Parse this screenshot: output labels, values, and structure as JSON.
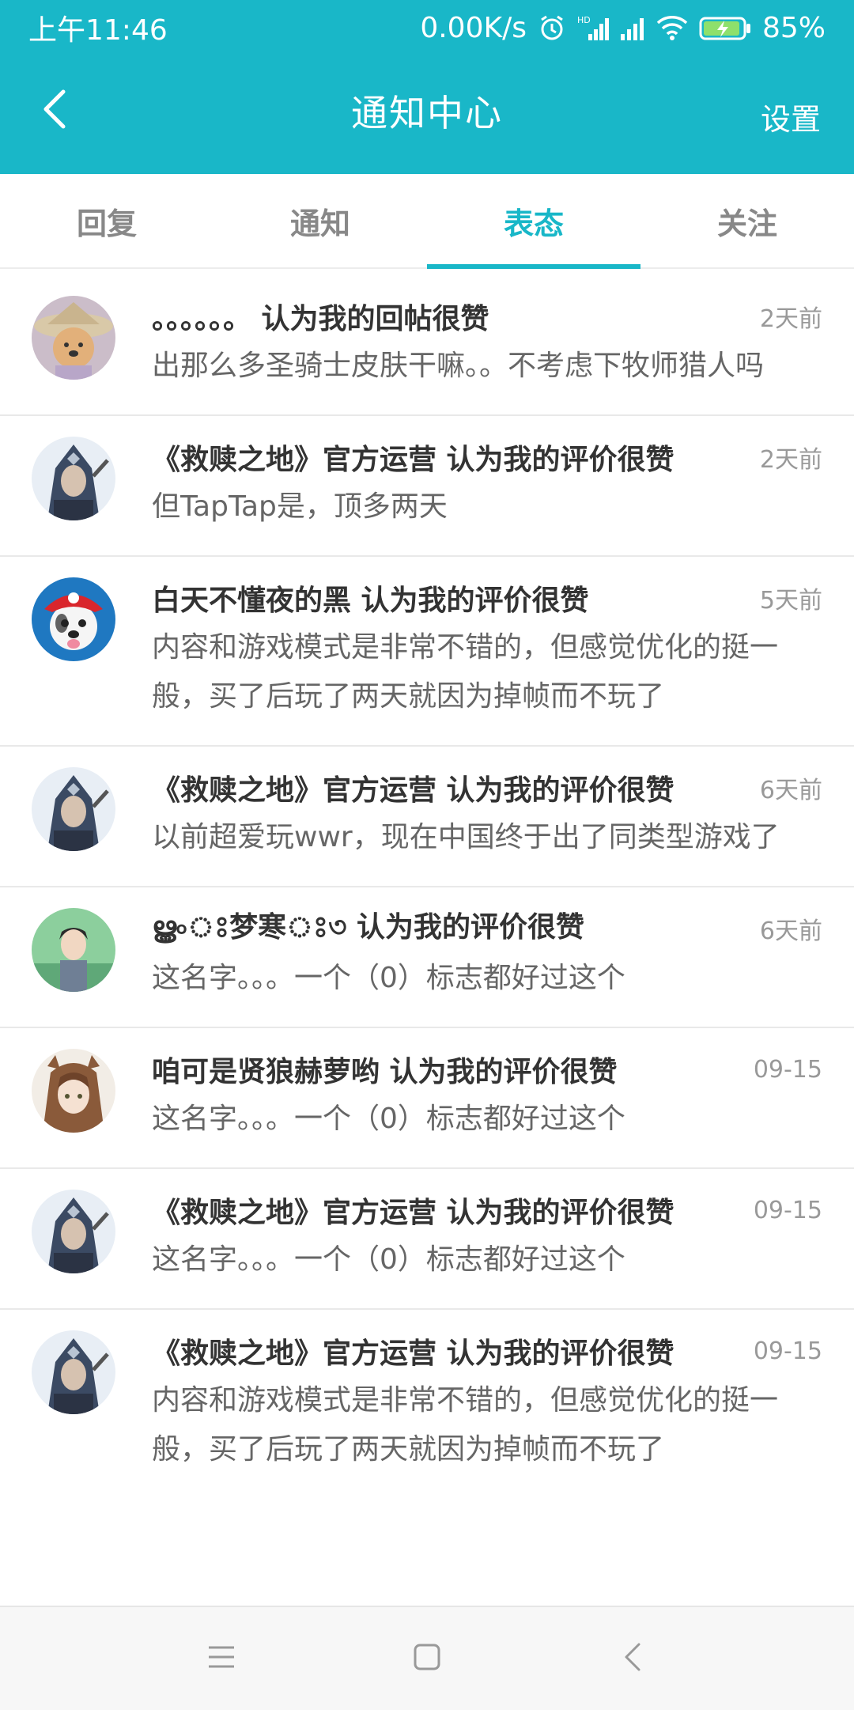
{
  "status_bar": {
    "time": "上午11:46",
    "network_speed": "0.00K/s",
    "battery": "85%",
    "icons": [
      "alarm-icon",
      "hd-signal-icon",
      "signal-icon",
      "wifi-icon",
      "battery-charging-icon"
    ]
  },
  "header": {
    "title": "通知中心",
    "settings_label": "设置",
    "back_icon": "chevron-left-icon"
  },
  "tabs": [
    {
      "label": "回复",
      "active": false
    },
    {
      "label": "通知",
      "active": false
    },
    {
      "label": "表态",
      "active": true
    },
    {
      "label": "关注",
      "active": false
    }
  ],
  "notifications": [
    {
      "title": "。。。。。。 认为我的回帖很赞",
      "time": "2天前",
      "body": "出那么多圣骑士皮肤干嘛。。不考虑下牧师猎人吗",
      "avatar": "avatar-dog-hat"
    },
    {
      "title": "《救赎之地》官方运营 认为我的评价很赞",
      "time": "2天前",
      "body": "但TapTap是，顶多两天",
      "avatar": "avatar-hooded-warrior"
    },
    {
      "title": "白天不懂夜的黑 认为我的评价很赞",
      "time": "5天前",
      "body": "内容和游戏模式是非常不错的，但感觉优化的挺一般，买了后玩了两天就因为掉帧而不玩了",
      "avatar": "avatar-pup-red-hat"
    },
    {
      "title": "《救赎之地》官方运营 认为我的评价很赞",
      "time": "6天前",
      "body": "以前超爱玩wwr，现在中国终于出了同类型游戏了",
      "avatar": "avatar-hooded-warrior"
    },
    {
      "title": "ൠ৹ঃ梦寒ঃ৩ 认为我的评价很赞",
      "time": "6天前",
      "body": "这名字。。。一个（0）标志都好过这个",
      "avatar": "avatar-anime-boy"
    },
    {
      "title": "咱可是贤狼赫萝哟 认为我的评价很赞",
      "time": "09-15",
      "body": "这名字。。。一个（0）标志都好过这个",
      "avatar": "avatar-wolf-girl"
    },
    {
      "title": "《救赎之地》官方运营 认为我的评价很赞",
      "time": "09-15",
      "body": "这名字。。。一个（0）标志都好过这个",
      "avatar": "avatar-hooded-warrior"
    },
    {
      "title": "《救赎之地》官方运营 认为我的评价很赞",
      "time": "09-15",
      "body": "内容和游戏模式是非常不错的，但感觉优化的挺一般，买了后玩了两天就因为掉帧而不玩了",
      "avatar": "avatar-hooded-warrior"
    }
  ],
  "nav_bar": {
    "icons": [
      "menu-icon",
      "home-icon",
      "back-icon"
    ]
  },
  "colors": {
    "accent": "#19b7c8",
    "title_text": "#333333",
    "body_text": "#666666",
    "time_text": "#999999"
  }
}
